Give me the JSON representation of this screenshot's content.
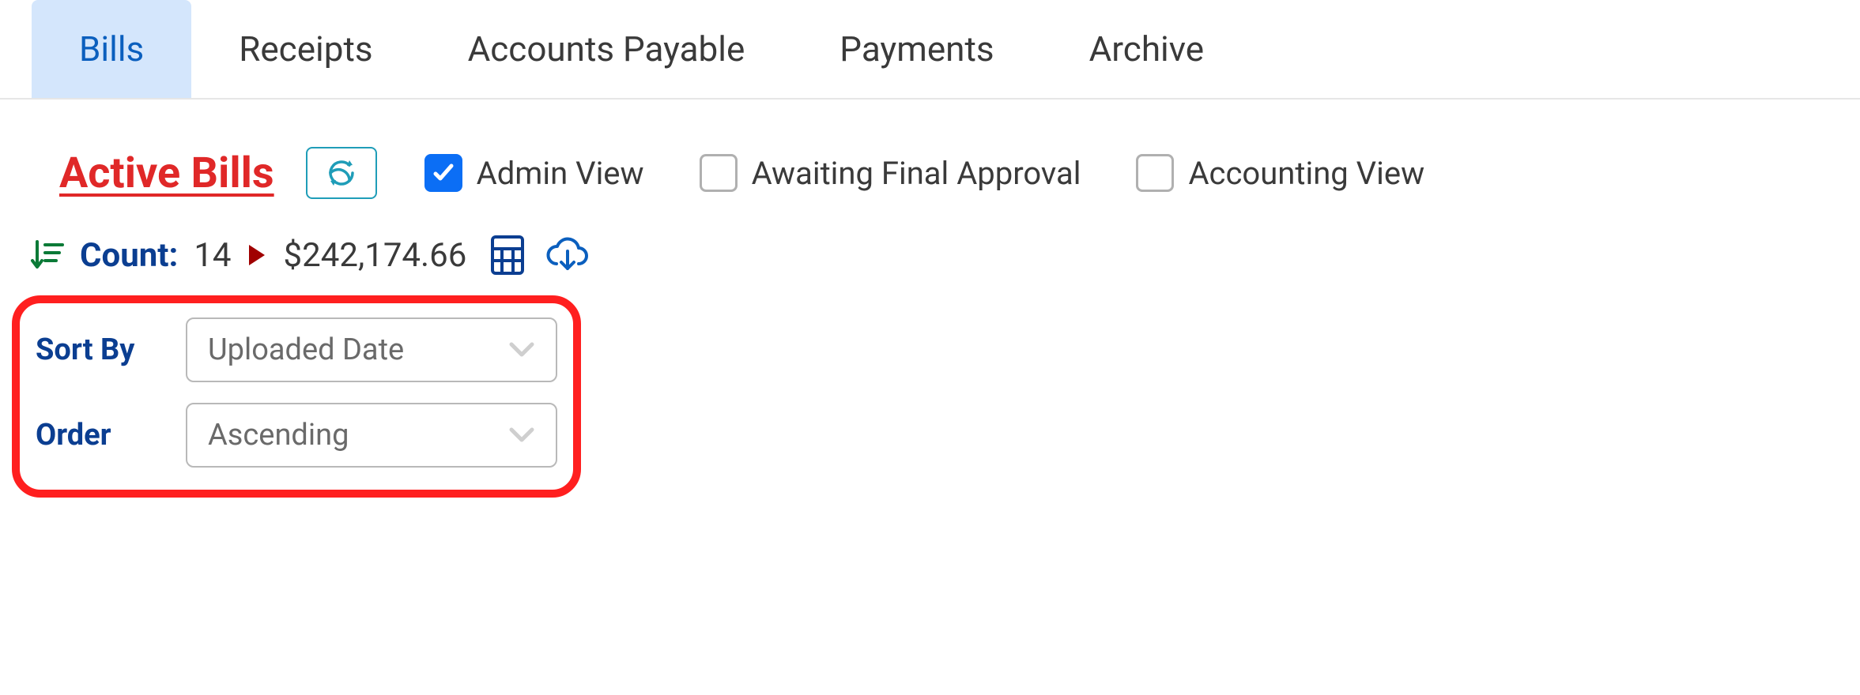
{
  "tabs": {
    "bills": "Bills",
    "receipts": "Receipts",
    "accounts_payable": "Accounts Payable",
    "payments": "Payments",
    "archive": "Archive",
    "active": "bills"
  },
  "title": {
    "text": "Active Bills"
  },
  "filters": {
    "admin_view": {
      "label": "Admin View",
      "checked": true
    },
    "awaiting_final_approval": {
      "label": "Awaiting Final Approval",
      "checked": false
    },
    "accounting_view": {
      "label": "Accounting View",
      "checked": false
    }
  },
  "stats": {
    "count_label": "Count:",
    "count_value": "14",
    "total_value": "$242,174.66"
  },
  "sort": {
    "sort_by_label": "Sort By",
    "sort_by_value": "Uploaded Date",
    "order_label": "Order",
    "order_value": "Ascending"
  }
}
